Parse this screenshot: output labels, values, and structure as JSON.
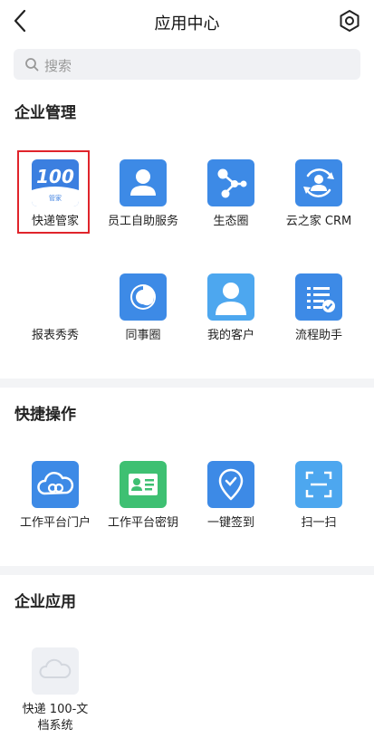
{
  "header": {
    "title": "应用中心"
  },
  "search": {
    "placeholder": "搜索"
  },
  "sections": {
    "enterprise_mgmt": {
      "title": "企业管理",
      "items": [
        {
          "label": "快递管家",
          "logo_text": "100",
          "logo_sub": "管家",
          "icon": "express-butler-logo"
        },
        {
          "label": "员工自助服务",
          "icon": "person-icon"
        },
        {
          "label": "生态圈",
          "icon": "nodes-icon"
        },
        {
          "label": "云之家 CRM",
          "icon": "crm-icon"
        },
        {
          "label": "报表秀秀",
          "icon": "report-chart-icon"
        },
        {
          "label": "同事圈",
          "icon": "circle-swirl-icon"
        },
        {
          "label": "我的客户",
          "icon": "customer-icon"
        },
        {
          "label": "流程助手",
          "icon": "process-list-icon"
        }
      ]
    },
    "quick_ops": {
      "title": "快捷操作",
      "items": [
        {
          "label": "工作平台门户",
          "icon": "cloud-link-icon"
        },
        {
          "label": "工作平台密钥",
          "icon": "id-card-icon"
        },
        {
          "label": "一键签到",
          "icon": "location-check-icon"
        },
        {
          "label": "扫一扫",
          "icon": "scan-icon"
        }
      ]
    },
    "enterprise_apps": {
      "title": "企业应用",
      "items": [
        {
          "label_line1": "快递 100-文",
          "label_line2": "档系统",
          "icon": "cloud-placeholder-icon"
        }
      ]
    }
  },
  "colors": {
    "blue": "#3d8ae6",
    "orange": "#ec6a36",
    "green": "#3ec072",
    "light_blue": "#4da7ef",
    "highlight_red": "#e0242b"
  }
}
